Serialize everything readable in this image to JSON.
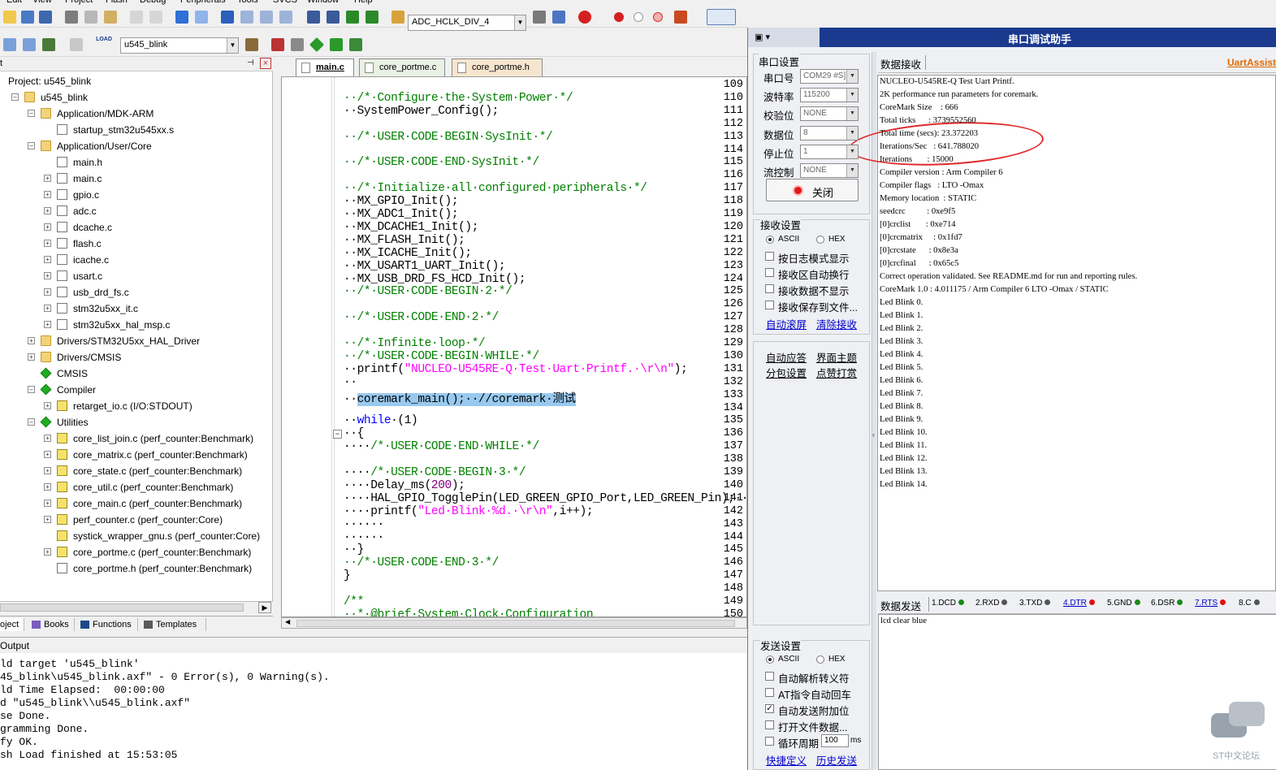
{
  "menu": [
    "Edit",
    "View",
    "Project",
    "Flash",
    "Debug",
    "Peripherals",
    "Tools",
    "SVCS",
    "Window",
    "Help"
  ],
  "toolbar": {
    "target_combo": "ADC_HCLK_DIV_4",
    "project_combo": "u545_blink",
    "load_label": "LOAD"
  },
  "project_panel": {
    "header": "t",
    "pin_glyph": "  p",
    "close_glyph": "×",
    "root": "Project: u545_blink",
    "items": [
      {
        "label": "u545_blink",
        "icon": "folder",
        "level": 0,
        "exp": "–"
      },
      {
        "label": "Application/MDK-ARM",
        "icon": "folder",
        "level": 1,
        "exp": "–"
      },
      {
        "label": "startup_stm32u545xx.s",
        "icon": "file",
        "level": 2,
        "exp": ""
      },
      {
        "label": "Application/User/Core",
        "icon": "folder",
        "level": 1,
        "exp": "–"
      },
      {
        "label": "main.h",
        "icon": "file",
        "level": 2,
        "exp": ""
      },
      {
        "label": "main.c",
        "icon": "file",
        "level": 2,
        "exp": "+"
      },
      {
        "label": "gpio.c",
        "icon": "file",
        "level": 2,
        "exp": "+"
      },
      {
        "label": "adc.c",
        "icon": "file",
        "level": 2,
        "exp": "+"
      },
      {
        "label": "dcache.c",
        "icon": "file",
        "level": 2,
        "exp": "+"
      },
      {
        "label": "flash.c",
        "icon": "file",
        "level": 2,
        "exp": "+"
      },
      {
        "label": "icache.c",
        "icon": "file",
        "level": 2,
        "exp": "+"
      },
      {
        "label": "usart.c",
        "icon": "file",
        "level": 2,
        "exp": "+"
      },
      {
        "label": "usb_drd_fs.c",
        "icon": "file",
        "level": 2,
        "exp": "+"
      },
      {
        "label": "stm32u5xx_it.c",
        "icon": "file",
        "level": 2,
        "exp": "+"
      },
      {
        "label": "stm32u5xx_hal_msp.c",
        "icon": "file",
        "level": 2,
        "exp": "+"
      },
      {
        "label": "Drivers/STM32U5xx_HAL_Driver",
        "icon": "folder",
        "level": 1,
        "exp": "+"
      },
      {
        "label": "Drivers/CMSIS",
        "icon": "folder",
        "level": 1,
        "exp": "+"
      },
      {
        "label": "CMSIS",
        "icon": "dia",
        "level": 1,
        "exp": ""
      },
      {
        "label": "Compiler",
        "icon": "dia",
        "level": 1,
        "exp": "–"
      },
      {
        "label": "retarget_io.c (I/O:STDOUT)",
        "icon": "key",
        "level": 2,
        "exp": "+"
      },
      {
        "label": "Utilities",
        "icon": "dia",
        "level": 1,
        "exp": "–"
      },
      {
        "label": "core_list_join.c (perf_counter:Benchmark)",
        "icon": "key",
        "level": 2,
        "exp": "+"
      },
      {
        "label": "core_matrix.c (perf_counter:Benchmark)",
        "icon": "key",
        "level": 2,
        "exp": "+"
      },
      {
        "label": "core_state.c (perf_counter:Benchmark)",
        "icon": "key",
        "level": 2,
        "exp": "+"
      },
      {
        "label": "core_util.c (perf_counter:Benchmark)",
        "icon": "key",
        "level": 2,
        "exp": "+"
      },
      {
        "label": "core_main.c (perf_counter:Benchmark)",
        "icon": "key",
        "level": 2,
        "exp": "+"
      },
      {
        "label": "perf_counter.c (perf_counter:Core)",
        "icon": "key",
        "level": 2,
        "exp": "+"
      },
      {
        "label": "systick_wrapper_gnu.s (perf_counter:Core)",
        "icon": "key",
        "level": 2,
        "exp": ""
      },
      {
        "label": "core_portme.c (perf_counter:Benchmark)",
        "icon": "key",
        "level": 2,
        "exp": "+"
      },
      {
        "label": "core_portme.h (perf_counter:Benchmark)",
        "icon": "file",
        "level": 2,
        "exp": ""
      }
    ],
    "bottom_tabs": [
      "oject",
      "Books",
      "Functions",
      "Templates"
    ]
  },
  "editor_tabs": [
    "main.c",
    "core_portme.c",
    "core_portme.h"
  ],
  "code": [
    {
      "n": "109",
      "parts": []
    },
    {
      "n": "110",
      "parts": [
        [
          "cm",
          "··/*·Configure·the·System·Power·*/"
        ]
      ]
    },
    {
      "n": "111",
      "parts": [
        [
          "",
          "··SystemPower_Config();"
        ]
      ]
    },
    {
      "n": "112",
      "parts": []
    },
    {
      "n": "113",
      "parts": [
        [
          "cm",
          "··/*·USER·CODE·BEGIN·SysInit·*/"
        ]
      ]
    },
    {
      "n": "114",
      "parts": []
    },
    {
      "n": "115",
      "parts": [
        [
          "cm",
          "··/*·USER·CODE·END·SysInit·*/"
        ]
      ]
    },
    {
      "n": "116",
      "parts": []
    },
    {
      "n": "117",
      "parts": [
        [
          "cm",
          "··/*·Initialize·all·configured·peripherals·*/"
        ]
      ]
    },
    {
      "n": "118",
      "parts": [
        [
          "",
          "··MX_GPIO_Init();"
        ]
      ]
    },
    {
      "n": "119",
      "parts": [
        [
          "",
          "··MX_ADC1_Init();"
        ]
      ]
    },
    {
      "n": "120",
      "parts": [
        [
          "",
          "··MX_DCACHE1_Init();"
        ]
      ]
    },
    {
      "n": "121",
      "parts": [
        [
          "",
          "··MX_FLASH_Init();"
        ]
      ]
    },
    {
      "n": "122",
      "parts": [
        [
          "",
          "··MX_ICACHE_Init();"
        ]
      ]
    },
    {
      "n": "123",
      "parts": [
        [
          "",
          "··MX_USART1_UART_Init();"
        ]
      ]
    },
    {
      "n": "124",
      "parts": [
        [
          "",
          "··MX_USB_DRD_FS_HCD_Init();"
        ]
      ]
    },
    {
      "n": "125",
      "parts": [
        [
          "cm",
          "··/*·USER·CODE·BEGIN·2·*/"
        ]
      ]
    },
    {
      "n": "126",
      "parts": []
    },
    {
      "n": "127",
      "parts": [
        [
          "cm",
          "··/*·USER·CODE·END·2·*/"
        ]
      ]
    },
    {
      "n": "128",
      "parts": []
    },
    {
      "n": "129",
      "parts": [
        [
          "cm",
          "··/*·Infinite·loop·*/"
        ]
      ]
    },
    {
      "n": "130",
      "parts": [
        [
          "cm",
          "··/*·USER·CODE·BEGIN·WHILE·*/"
        ]
      ]
    },
    {
      "n": "131",
      "parts": [
        [
          "",
          "··printf("
        ],
        [
          "st",
          "\"NUCLEO-U545RE-Q·Test·Uart·Printf.·\\r\\n\""
        ],
        [
          "",
          ");"
        ]
      ]
    },
    {
      "n": "132",
      "parts": [
        [
          "",
          "··"
        ]
      ]
    },
    {
      "n": "133",
      "parts": [
        [
          "",
          "··"
        ],
        [
          "sel",
          "coremark_main();··//coremark·测试"
        ]
      ]
    },
    {
      "n": "134",
      "parts": []
    },
    {
      "n": "135",
      "parts": [
        [
          "",
          "··"
        ],
        [
          "kw",
          "while"
        ],
        [
          "",
          "·(1)"
        ]
      ]
    },
    {
      "n": "136",
      "parts": [
        [
          "",
          "··{"
        ]
      ]
    },
    {
      "n": "137",
      "parts": [
        [
          "",
          "····"
        ],
        [
          "cm",
          "/*·USER·CODE·END·WHILE·*/"
        ]
      ]
    },
    {
      "n": "138",
      "parts": []
    },
    {
      "n": "139",
      "parts": [
        [
          "",
          "····"
        ],
        [
          "cm",
          "/*·USER·CODE·BEGIN·3·*/"
        ]
      ]
    },
    {
      "n": "140",
      "parts": [
        [
          "",
          "····Delay_ms("
        ],
        [
          "nm",
          "200"
        ],
        [
          "",
          ");"
        ]
      ]
    },
    {
      "n": "141",
      "parts": [
        [
          "",
          "····HAL_GPIO_TogglePin(LED_GREEN_GPIO_Port,LED_GREEN_Pin);··"
        ],
        [
          "cm",
          "//"
        ]
      ]
    },
    {
      "n": "142",
      "parts": [
        [
          "",
          "····printf("
        ],
        [
          "st",
          "\"Led·Blink·%d.·\\r\\n\""
        ],
        [
          "",
          ",i++);"
        ]
      ]
    },
    {
      "n": "143",
      "parts": [
        [
          "",
          "······"
        ]
      ]
    },
    {
      "n": "144",
      "parts": [
        [
          "",
          "······"
        ]
      ]
    },
    {
      "n": "145",
      "parts": [
        [
          "",
          "··}"
        ]
      ]
    },
    {
      "n": "146",
      "parts": [
        [
          "cm",
          "··/*·USER·CODE·END·3·*/"
        ]
      ]
    },
    {
      "n": "147",
      "parts": [
        [
          "",
          "}"
        ]
      ]
    },
    {
      "n": "148",
      "parts": []
    },
    {
      "n": "149",
      "parts": [
        [
          "cm",
          "/**"
        ]
      ]
    },
    {
      "n": "150",
      "parts": [
        [
          "cm",
          "··*·@brief·System·Clock·Configuration"
        ]
      ]
    }
  ],
  "output": {
    "title": "Output",
    "lines": [
      "ld target 'u545_blink'",
      "45_blink\\u545_blink.axf\" - 0 Error(s), 0 Warning(s).",
      "ld Time Elapsed:  00:00:00",
      "d \"u545_blink\\\\u545_blink.axf\"",
      "se Done.",
      "gramming Done.",
      "fy OK.",
      "sh Load finished at 15:53:05"
    ]
  },
  "serial": {
    "title": "串口调试助手",
    "brand": "UartAssist",
    "port_group": "串口设置",
    "fields": [
      {
        "label": "串口号",
        "value": "COM29 #S]"
      },
      {
        "label": "波特率",
        "value": "115200"
      },
      {
        "label": "校验位",
        "value": "NONE"
      },
      {
        "label": "数据位",
        "value": "8"
      },
      {
        "label": "停止位",
        "value": "1"
      },
      {
        "label": "流控制",
        "value": "NONE"
      }
    ],
    "close_btn": "关闭",
    "recv_group": "接收设置",
    "ascii": "ASCII",
    "hex": "HEX",
    "recv_opts": [
      "按日志模式显示",
      "接收区自动换行",
      "接收数据不显示",
      "接收保存到文件..."
    ],
    "auto_scroll": "自动滚屏",
    "clear_recv": "清除接收",
    "auto_reply": "自动应答",
    "ui_theme": "界面主题",
    "packet_set": "分包设置",
    "tip": "点赞打赏",
    "send_group": "发送设置",
    "send_opts": [
      "自动解析转义符",
      "AT指令自动回车",
      "自动发送附加位",
      "打开文件数据...",
      "循环周期"
    ],
    "period_value": "100",
    "period_unit": "ms",
    "shortcut": "快捷定义",
    "history": "历史发送",
    "recv_title": "数据接收",
    "send_title": "数据发送",
    "pins": [
      {
        "label": "1.DCD",
        "color": "#1a8a1a"
      },
      {
        "label": "2.RXD",
        "color": "#555555"
      },
      {
        "label": "3.TXD",
        "color": "#555555"
      },
      {
        "label": "4.DTR",
        "color": "#e01010"
      },
      {
        "label": "5.GND",
        "color": "#1a8a1a"
      },
      {
        "label": "6.DSR",
        "color": "#1a8a1a"
      },
      {
        "label": "7.RTS",
        "color": "#e01010"
      },
      {
        "label": "8.C",
        "color": "#555555"
      }
    ],
    "send_text": "lcd clear blue",
    "recv_lines": [
      "NUCLEO-U545RE-Q Test Uart Printf.",
      "2K performance run parameters for coremark.",
      "CoreMark Size    : 666",
      "Total ticks      : 3739552560",
      "Total time (secs): 23.372203",
      "Iterations/Sec   : 641.788020",
      "Iterations       : 15000",
      "Compiler version : Arm Compiler 6",
      "Compiler flags   : LTO -Omax",
      "Memory location  : STATIC",
      "seedcrc          : 0xe9f5",
      "[0]crclist       : 0xe714",
      "[0]crcmatrix     : 0x1fd7",
      "[0]crcstate      : 0x8e3a",
      "[0]crcfinal      : 0x65c5",
      "Correct operation validated. See README.md for run and reporting rules.",
      "CoreMark 1.0 : 4.011175 / Arm Compiler 6 LTO -Omax / STATIC",
      "Led Blink 0.",
      "Led Blink 1.",
      "Led Blink 2.",
      "Led Blink 3.",
      "Led Blink 4.",
      "Led Blink 5.",
      "Led Blink 6.",
      "Led Blink 7.",
      "Led Blink 8.",
      "Led Blink 9.",
      "Led Blink 10.",
      "Led Blink 11.",
      "Led Blink 12.",
      "Led Blink 13.",
      "Led Blink 14."
    ],
    "watermark": "ST中文论坛"
  }
}
